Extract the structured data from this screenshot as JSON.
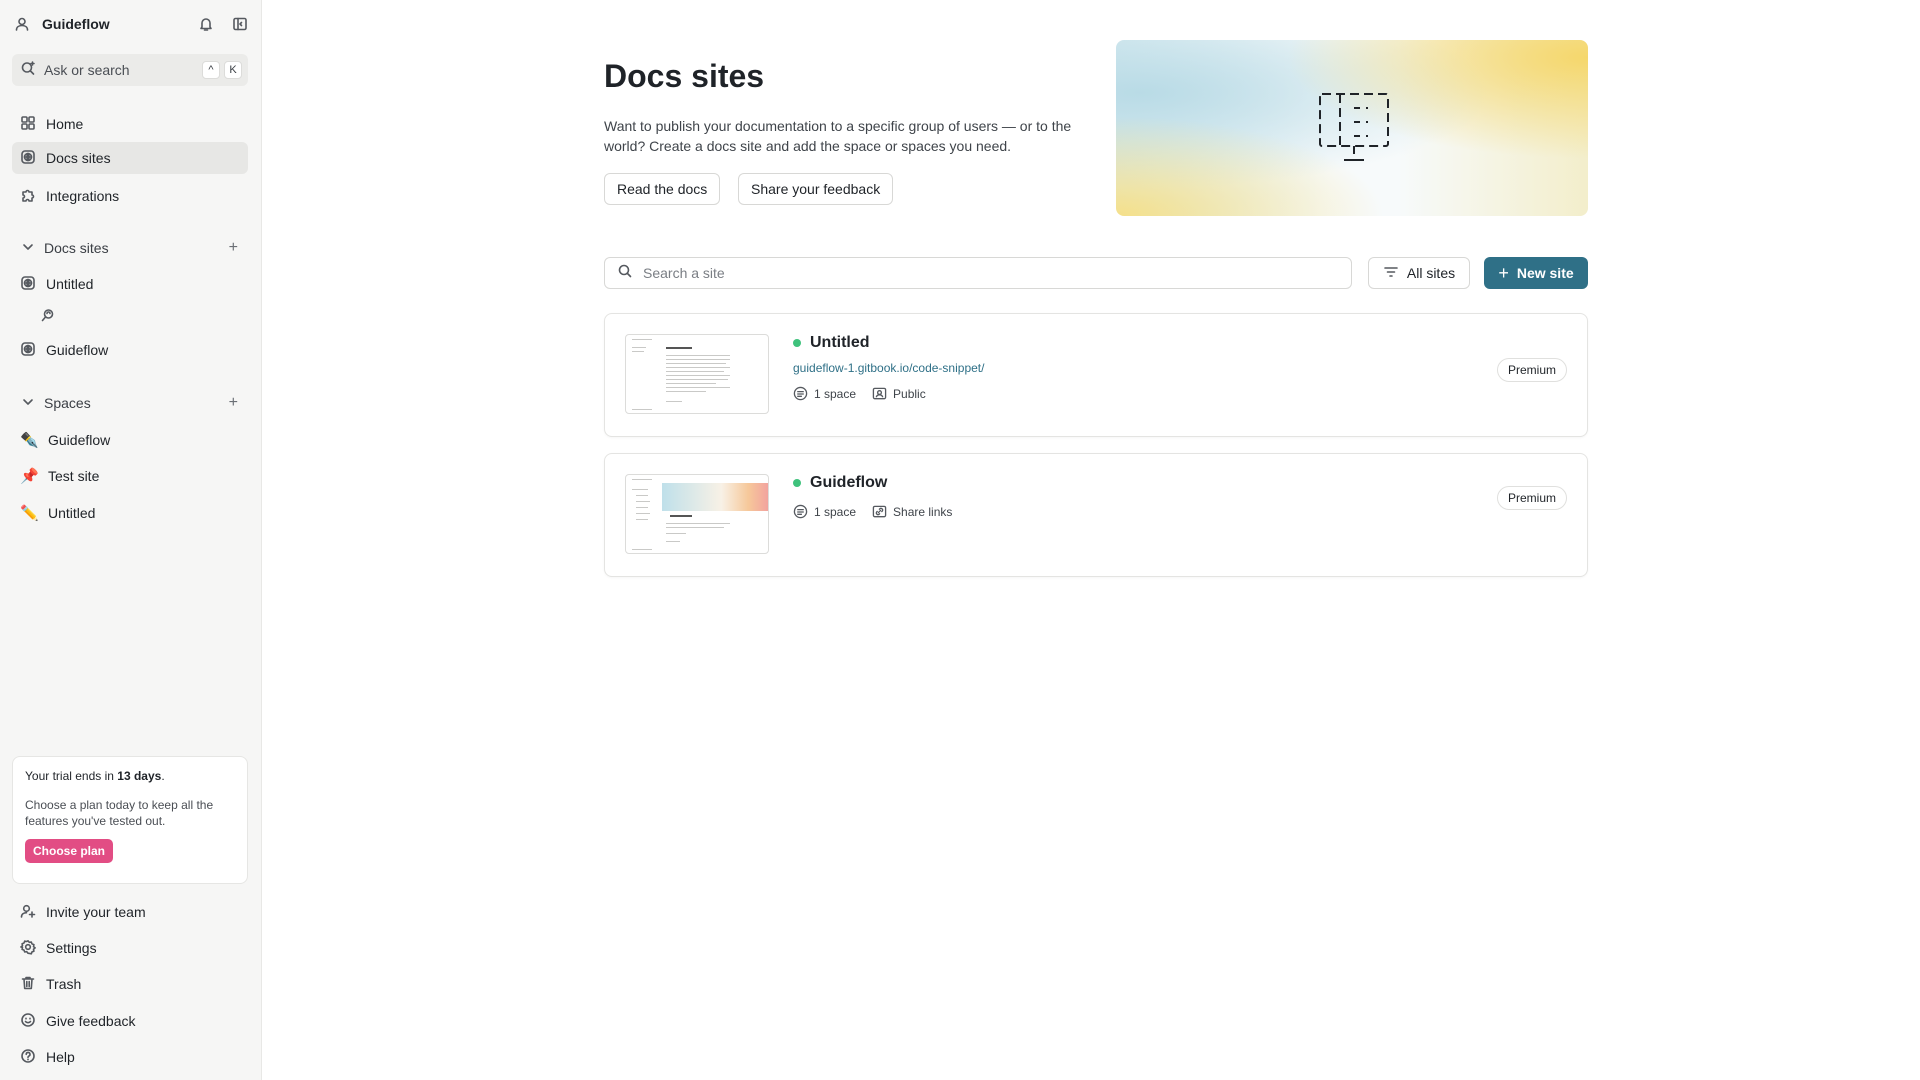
{
  "sidebar": {
    "workspace_name": "Guideflow",
    "search_placeholder": "Ask or search",
    "shortcut_keys": [
      "^",
      "K"
    ],
    "nav": [
      {
        "label": "Home",
        "icon": "grid-icon"
      },
      {
        "label": "Docs sites",
        "icon": "globe-icon",
        "active": true
      },
      {
        "label": "Integrations",
        "icon": "puzzle-icon"
      }
    ],
    "docs_sites_section": {
      "title": "Docs sites",
      "items": [
        {
          "label": "Untitled",
          "icon": "globe-icon"
        },
        {
          "label": "Guideflow",
          "icon": "globe-icon"
        }
      ]
    },
    "spaces_section": {
      "title": "Spaces",
      "items": [
        {
          "label": "Guideflow",
          "emoji": "✒️"
        },
        {
          "label": "Test site",
          "emoji": "📌"
        },
        {
          "label": "Untitled",
          "emoji": "✏️"
        }
      ]
    },
    "trial": {
      "title_prefix": "Your trial ends in ",
      "days": "13 days",
      "title_suffix": ".",
      "text": "Choose a plan today to keep all the features you've tested out.",
      "button": "Choose plan"
    },
    "footer": [
      {
        "label": "Invite your team",
        "icon": "user-plus-icon"
      },
      {
        "label": "Settings",
        "icon": "gear-icon"
      },
      {
        "label": "Trash",
        "icon": "trash-icon"
      },
      {
        "label": "Give feedback",
        "icon": "smiley-icon"
      },
      {
        "label": "Help",
        "icon": "help-circle-icon"
      }
    ]
  },
  "main": {
    "title": "Docs sites",
    "description": "Want to publish your documentation to a specific group of users — or to the world? Create a docs site and add the space or spaces you need.",
    "read_docs": "Read the docs",
    "share_feedback": "Share your feedback",
    "search_placeholder": "Search a site",
    "filter_label": "All sites",
    "new_site_label": "New site",
    "sites": [
      {
        "title": "Untitled",
        "url": "guideflow-1.gitbook.io/code-snippet/",
        "spaces": "1 space",
        "visibility": "Public",
        "plan": "Premium"
      },
      {
        "title": "Guideflow",
        "url": "",
        "spaces": "1 space",
        "visibility": "Share links",
        "plan": "Premium"
      }
    ]
  },
  "colors": {
    "accent": "#2f7087",
    "trial_button": "#e24d84",
    "status_dot": "#3fc27c"
  }
}
